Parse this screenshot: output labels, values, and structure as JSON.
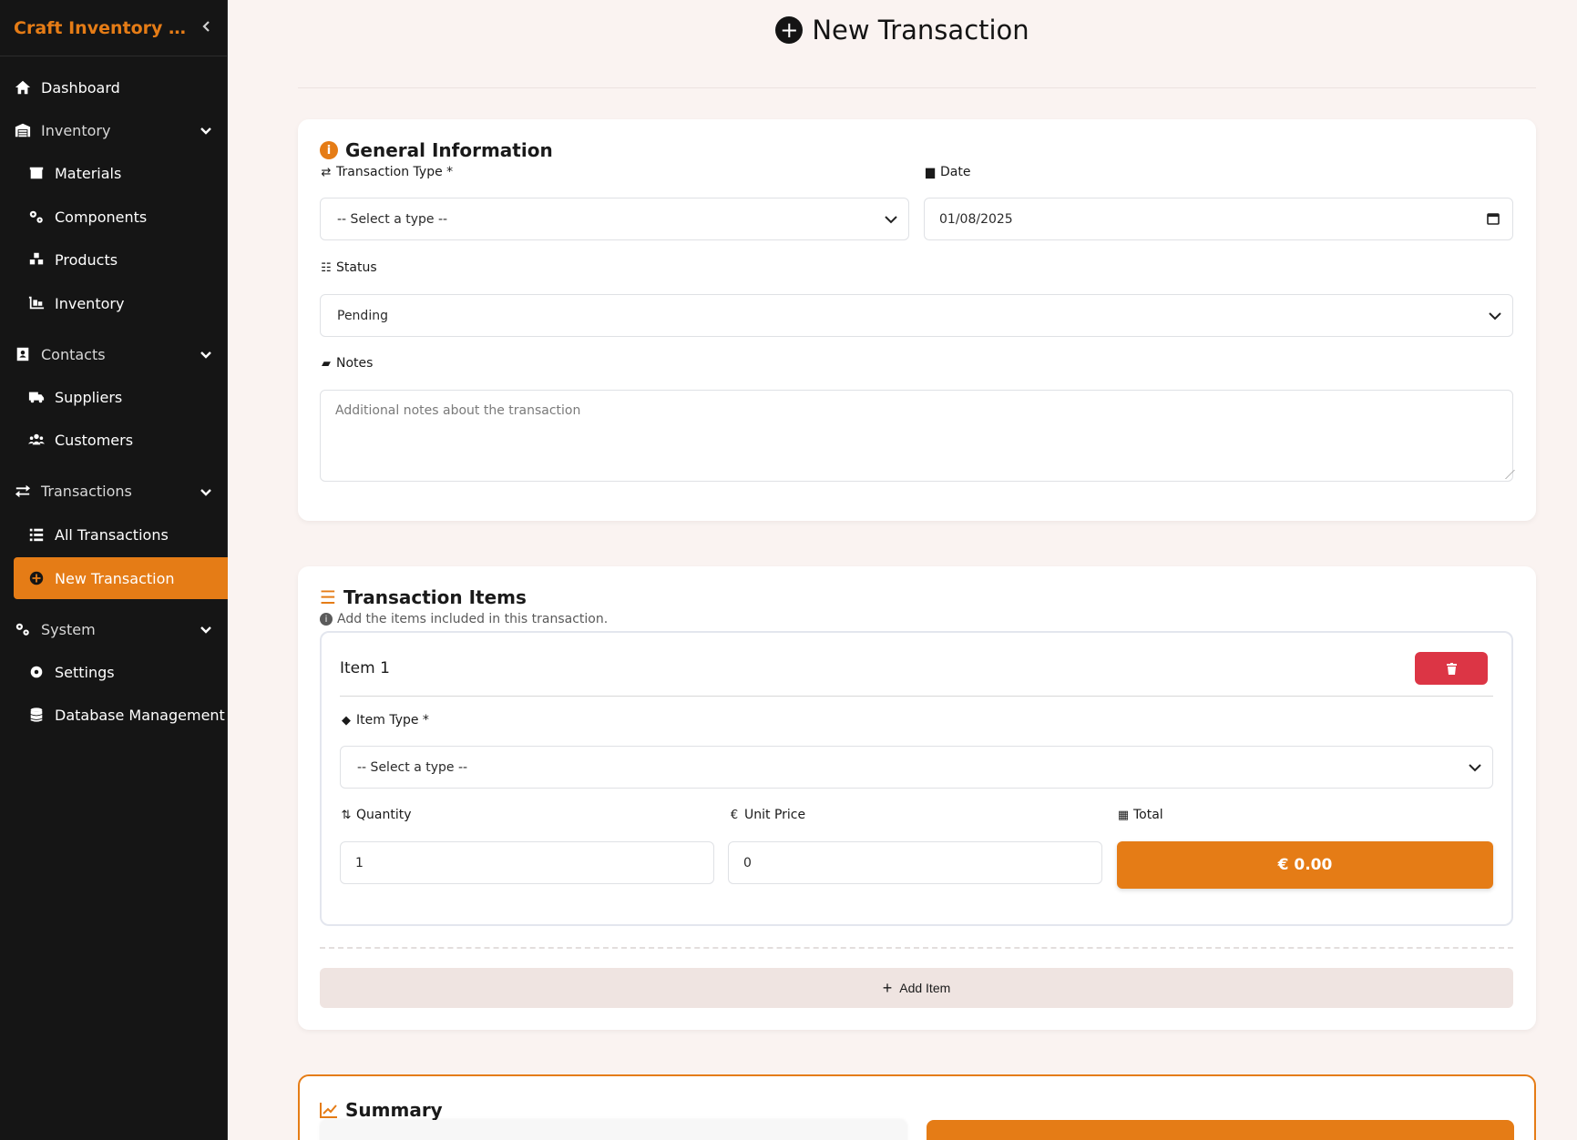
{
  "app": {
    "title": "Craft Inventory Management",
    "title_display": "Craft Inventory Man..."
  },
  "sidebar": {
    "dashboard": "Dashboard",
    "inventory_group": "Inventory",
    "materials": "Materials",
    "components": "Components",
    "products": "Products",
    "inventory": "Inventory",
    "contacts_group": "Contacts",
    "suppliers": "Suppliers",
    "customers": "Customers",
    "transactions_group": "Transactions",
    "all_transactions": "All Transactions",
    "new_transaction": "New Transaction",
    "system_group": "System",
    "settings": "Settings",
    "database_management": "Database Management"
  },
  "page": {
    "title": "New Transaction"
  },
  "general": {
    "title": "General Information",
    "transaction_type_label": "Transaction Type *",
    "transaction_type_value": "-- Select a type --",
    "date_label": "Date",
    "date_value": "01/08/2025",
    "status_label": "Status",
    "status_value": "Pending",
    "notes_label": "Notes",
    "notes_placeholder": "Additional notes about the transaction"
  },
  "items": {
    "title": "Transaction Items",
    "hint": "Add the items included in this transaction.",
    "item1": {
      "title": "Item 1",
      "item_type_label": "Item Type *",
      "item_type_value": "-- Select a type --",
      "quantity_label": "Quantity",
      "quantity_value": "1",
      "unit_price_label": "Unit Price",
      "unit_price_value": "0",
      "total_label": "Total",
      "total_value": "€ 0.00"
    },
    "add_item": "Add Item"
  },
  "summary": {
    "title": "Summary"
  },
  "colors": {
    "accent": "#e57c16",
    "danger": "#dc3545",
    "sidebar_bg": "#151515",
    "page_bg": "#faf3f1"
  }
}
